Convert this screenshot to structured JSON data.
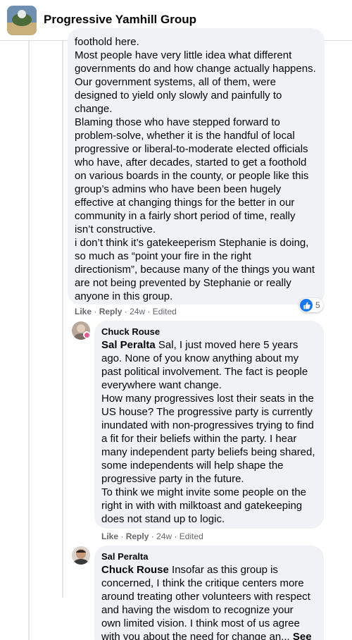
{
  "group": {
    "name": "Progressive Yamhill Group"
  },
  "comment1": {
    "cut_text": "foothold here.",
    "paragraphs": [
      "Most people have very little idea what different governments do and how change actually happens. Our government systems, all of them, were designed to yield only slowly and painfully to change.",
      "Blaming those who have stepped forward to problem-solve, whether it is the handful of local progressive or liberal-to-moderate elected officials who have, after decades, started to get a foothold on various boards in the county, or people like this group’s admins who have been been hugely effective at changing things for the better in our community in a fairly short period of time, really isn’t constructive.",
      "i don’t think it’s gatekeeperism Stephanie is doing, so much as “point your fire in the right directionism”, because many of the things you want are not being prevented by Stephanie or really anyone in this group."
    ],
    "like_label": "Like",
    "reply_label": "Reply",
    "time": "24w",
    "edited": "Edited",
    "reaction_count": "5"
  },
  "comment2": {
    "author": "Chuck Rouse",
    "mention": "Sal Peralta",
    "lead": " Sal, I just moved here 5 years ago. None of you know anything about my past political involvement. The fact is people everywhere want change.",
    "paragraphs": [
      "How many progressives lost their seats in the US house? The progressive party is currently inundated with non-progressives trying to find a fit for their beliefs within the party. I hear many independent party beliefs being shared, some independents will help shape the progressive party in the future.",
      "To think we might invite some people on the right in with with milktoast and gatekeeping does not stand up to logic."
    ],
    "like_label": "Like",
    "reply_label": "Reply",
    "time": "24w",
    "edited": "Edited"
  },
  "comment3": {
    "author": "Sal Peralta",
    "mention": "Chuck Rouse",
    "text": " Insofar as this group is concerned, I think the critique centers more around treating other volunteers with respect and having the wisdom to recognize your own limited vision. I think most of us agree with you about the need for change an...",
    "see_more": "See more"
  },
  "colors": {
    "bubble": "#f0f2f5",
    "like_blue": "#1877f2",
    "meta_gray": "#65676b"
  }
}
